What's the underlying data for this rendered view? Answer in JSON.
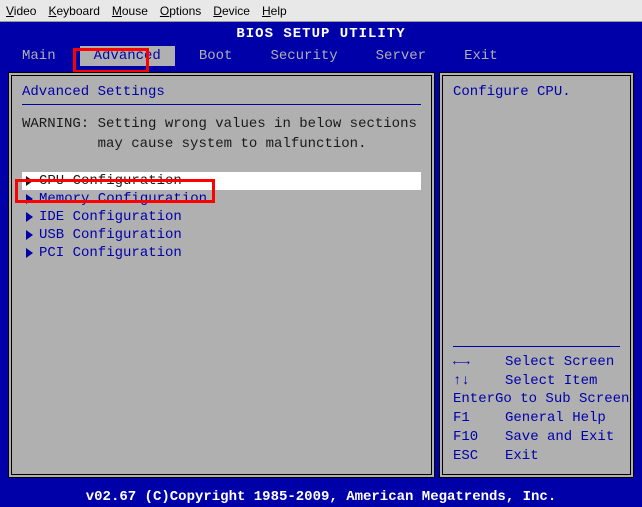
{
  "window_menu": [
    "Video",
    "Keyboard",
    "Mouse",
    "Options",
    "Device",
    "Help"
  ],
  "title": "BIOS SETUP UTILITY",
  "tabs": [
    "Main",
    "Advanced",
    "Boot",
    "Security",
    "Server",
    "Exit"
  ],
  "active_tab": "Advanced",
  "left": {
    "heading": "Advanced Settings",
    "warning_label": "WARNING:",
    "warning_text1": "Setting wrong values in below sections",
    "warning_text2": "may cause system to malfunction.",
    "items": [
      "CPU Configuration",
      "Memory Configuration",
      "IDE Configuration",
      "USB Configuration",
      "PCI Configuration"
    ],
    "selected_index": 0
  },
  "right": {
    "description": "Configure CPU.",
    "help": [
      {
        "key": "←→",
        "action": "Select Screen"
      },
      {
        "key": "↑↓",
        "action": "Select Item"
      },
      {
        "key": "Enter",
        "action": "Go to Sub Screen"
      },
      {
        "key": "F1",
        "action": "General Help"
      },
      {
        "key": "F10",
        "action": "Save and Exit"
      },
      {
        "key": "ESC",
        "action": "Exit"
      }
    ]
  },
  "footer": "v02.67 (C)Copyright 1985-2009, American Megatrends, Inc."
}
